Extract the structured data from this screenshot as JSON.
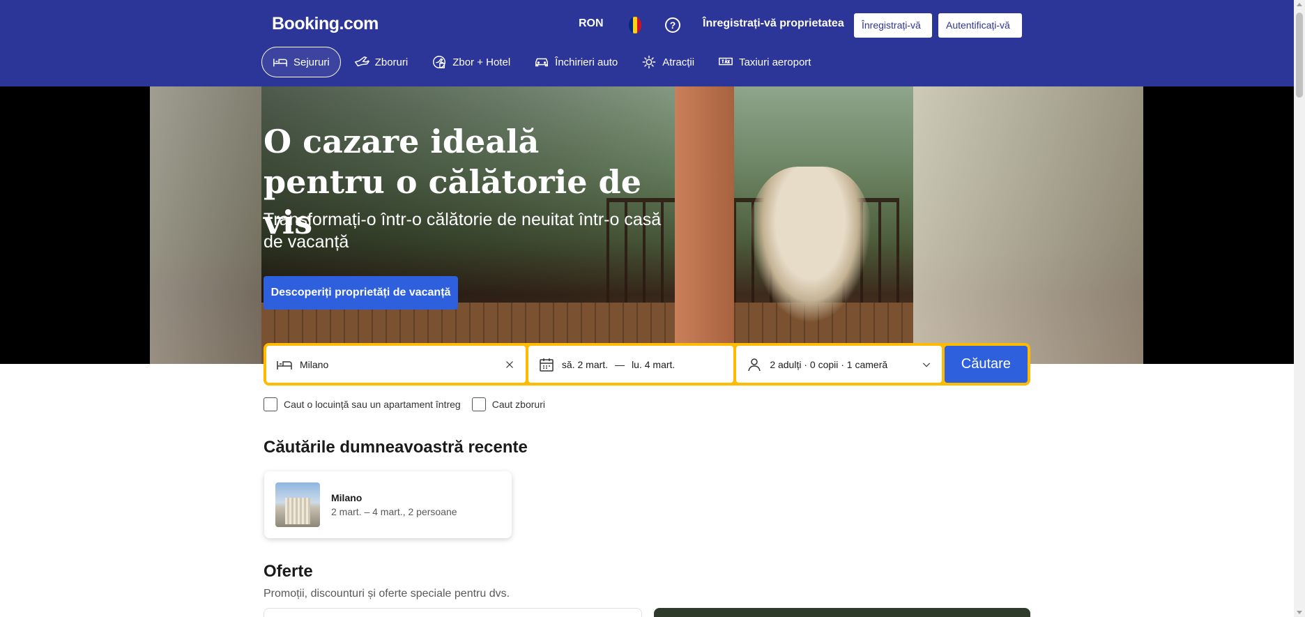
{
  "header": {
    "logo": "Booking.com",
    "currency": "RON",
    "flag_colors": [
      "#002b7f",
      "#fcd116",
      "#ce1126"
    ],
    "help_label": "?",
    "register_property": "Înregistrați-vă proprietatea",
    "register_button": "Înregistrați-vă",
    "login_button": "Autentificați-vă",
    "brand_color": "#2c3598"
  },
  "nav": {
    "items": [
      {
        "label": "Sejururi",
        "icon": "bed-icon",
        "active": true
      },
      {
        "label": "Zboruri",
        "icon": "plane-icon",
        "active": false
      },
      {
        "label": "Zbor + Hotel",
        "icon": "flight-hotel-icon",
        "active": false
      },
      {
        "label": "Închirieri auto",
        "icon": "car-icon",
        "active": false
      },
      {
        "label": "Atracții",
        "icon": "attractions-icon",
        "active": false
      },
      {
        "label": "Taxiuri aeroport",
        "icon": "taxi-icon",
        "active": false
      }
    ]
  },
  "hero": {
    "title_line1": "O cazare ideală",
    "title_line2": "pentru o călătorie de vis",
    "subtitle": "Transformați-o într-o călătorie de neuitat într-o casă de vacanță",
    "cta": "Descoperiți proprietăți de vacanță"
  },
  "search": {
    "destination_value": "Milano",
    "checkin": "să. 2 mart.",
    "date_separator": "—",
    "checkout": "lu. 4 mart.",
    "guests": "2 adulți · 0 copii · 1 cameră",
    "button": "Căutare",
    "accent_color": "#febb02",
    "button_color": "#2e5fdc"
  },
  "options": {
    "apartment_label": "Caut o locuință sau un apartament întreg",
    "flights_label": "Caut zboruri"
  },
  "recent": {
    "title": "Căutările dumneavoastră recente",
    "items": [
      {
        "city": "Milano",
        "details": "2 mart. – 4 mart., 2 persoane"
      }
    ]
  },
  "offers": {
    "title": "Oferte",
    "subtitle": "Promoții, discounturi și oferte speciale pentru dvs."
  }
}
